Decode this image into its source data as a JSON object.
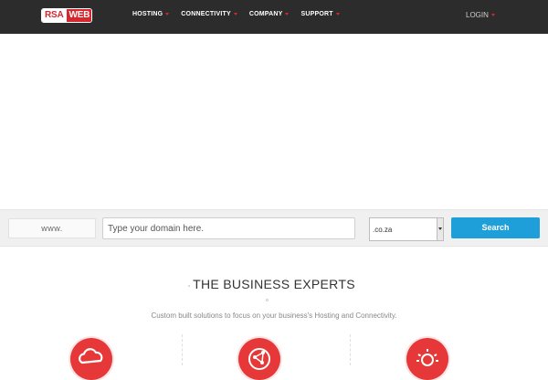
{
  "header": {
    "logo_left": "RSA",
    "logo_right": "WEB",
    "nav": [
      {
        "label": "HOSTING"
      },
      {
        "label": "CONNECTIVITY"
      },
      {
        "label": "COMPANY"
      },
      {
        "label": "SUPPORT"
      }
    ],
    "login_label": "LOGIN"
  },
  "domain_search": {
    "www_label": "www.",
    "placeholder": "Type your domain here.",
    "tld_selected": ".co.za",
    "button_label": "Search"
  },
  "business": {
    "heading": "THE BUSINESS EXPERTS",
    "subtext": "Custom built solutions to focus on your business's Hosting and Connectivity."
  },
  "features": [
    {
      "icon": "cloud-icon"
    },
    {
      "icon": "network-icon"
    },
    {
      "icon": "lightbulb-icon"
    }
  ],
  "colors": {
    "header_bg": "#2c2c2c",
    "brand_red": "#d8262e",
    "search_button": "#1e9fd9",
    "feature_icon": "#e63838"
  }
}
